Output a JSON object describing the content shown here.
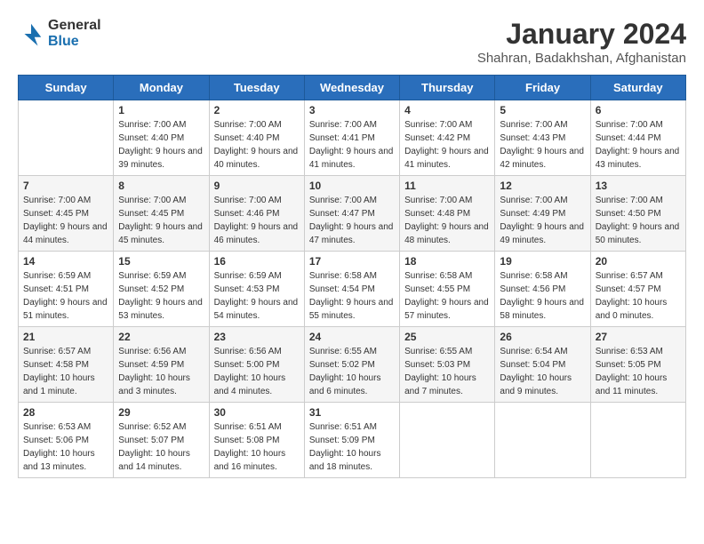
{
  "logo": {
    "general": "General",
    "blue": "Blue"
  },
  "title": "January 2024",
  "subtitle": "Shahran, Badakhshan, Afghanistan",
  "days_header": [
    "Sunday",
    "Monday",
    "Tuesday",
    "Wednesday",
    "Thursday",
    "Friday",
    "Saturday"
  ],
  "weeks": [
    [
      {
        "day": "",
        "sunrise": "",
        "sunset": "",
        "daylight": ""
      },
      {
        "day": "1",
        "sunrise": "Sunrise: 7:00 AM",
        "sunset": "Sunset: 4:40 PM",
        "daylight": "Daylight: 9 hours and 39 minutes."
      },
      {
        "day": "2",
        "sunrise": "Sunrise: 7:00 AM",
        "sunset": "Sunset: 4:40 PM",
        "daylight": "Daylight: 9 hours and 40 minutes."
      },
      {
        "day": "3",
        "sunrise": "Sunrise: 7:00 AM",
        "sunset": "Sunset: 4:41 PM",
        "daylight": "Daylight: 9 hours and 41 minutes."
      },
      {
        "day": "4",
        "sunrise": "Sunrise: 7:00 AM",
        "sunset": "Sunset: 4:42 PM",
        "daylight": "Daylight: 9 hours and 41 minutes."
      },
      {
        "day": "5",
        "sunrise": "Sunrise: 7:00 AM",
        "sunset": "Sunset: 4:43 PM",
        "daylight": "Daylight: 9 hours and 42 minutes."
      },
      {
        "day": "6",
        "sunrise": "Sunrise: 7:00 AM",
        "sunset": "Sunset: 4:44 PM",
        "daylight": "Daylight: 9 hours and 43 minutes."
      }
    ],
    [
      {
        "day": "7",
        "sunrise": "Sunrise: 7:00 AM",
        "sunset": "Sunset: 4:45 PM",
        "daylight": "Daylight: 9 hours and 44 minutes."
      },
      {
        "day": "8",
        "sunrise": "Sunrise: 7:00 AM",
        "sunset": "Sunset: 4:45 PM",
        "daylight": "Daylight: 9 hours and 45 minutes."
      },
      {
        "day": "9",
        "sunrise": "Sunrise: 7:00 AM",
        "sunset": "Sunset: 4:46 PM",
        "daylight": "Daylight: 9 hours and 46 minutes."
      },
      {
        "day": "10",
        "sunrise": "Sunrise: 7:00 AM",
        "sunset": "Sunset: 4:47 PM",
        "daylight": "Daylight: 9 hours and 47 minutes."
      },
      {
        "day": "11",
        "sunrise": "Sunrise: 7:00 AM",
        "sunset": "Sunset: 4:48 PM",
        "daylight": "Daylight: 9 hours and 48 minutes."
      },
      {
        "day": "12",
        "sunrise": "Sunrise: 7:00 AM",
        "sunset": "Sunset: 4:49 PM",
        "daylight": "Daylight: 9 hours and 49 minutes."
      },
      {
        "day": "13",
        "sunrise": "Sunrise: 7:00 AM",
        "sunset": "Sunset: 4:50 PM",
        "daylight": "Daylight: 9 hours and 50 minutes."
      }
    ],
    [
      {
        "day": "14",
        "sunrise": "Sunrise: 6:59 AM",
        "sunset": "Sunset: 4:51 PM",
        "daylight": "Daylight: 9 hours and 51 minutes."
      },
      {
        "day": "15",
        "sunrise": "Sunrise: 6:59 AM",
        "sunset": "Sunset: 4:52 PM",
        "daylight": "Daylight: 9 hours and 53 minutes."
      },
      {
        "day": "16",
        "sunrise": "Sunrise: 6:59 AM",
        "sunset": "Sunset: 4:53 PM",
        "daylight": "Daylight: 9 hours and 54 minutes."
      },
      {
        "day": "17",
        "sunrise": "Sunrise: 6:58 AM",
        "sunset": "Sunset: 4:54 PM",
        "daylight": "Daylight: 9 hours and 55 minutes."
      },
      {
        "day": "18",
        "sunrise": "Sunrise: 6:58 AM",
        "sunset": "Sunset: 4:55 PM",
        "daylight": "Daylight: 9 hours and 57 minutes."
      },
      {
        "day": "19",
        "sunrise": "Sunrise: 6:58 AM",
        "sunset": "Sunset: 4:56 PM",
        "daylight": "Daylight: 9 hours and 58 minutes."
      },
      {
        "day": "20",
        "sunrise": "Sunrise: 6:57 AM",
        "sunset": "Sunset: 4:57 PM",
        "daylight": "Daylight: 10 hours and 0 minutes."
      }
    ],
    [
      {
        "day": "21",
        "sunrise": "Sunrise: 6:57 AM",
        "sunset": "Sunset: 4:58 PM",
        "daylight": "Daylight: 10 hours and 1 minute."
      },
      {
        "day": "22",
        "sunrise": "Sunrise: 6:56 AM",
        "sunset": "Sunset: 4:59 PM",
        "daylight": "Daylight: 10 hours and 3 minutes."
      },
      {
        "day": "23",
        "sunrise": "Sunrise: 6:56 AM",
        "sunset": "Sunset: 5:00 PM",
        "daylight": "Daylight: 10 hours and 4 minutes."
      },
      {
        "day": "24",
        "sunrise": "Sunrise: 6:55 AM",
        "sunset": "Sunset: 5:02 PM",
        "daylight": "Daylight: 10 hours and 6 minutes."
      },
      {
        "day": "25",
        "sunrise": "Sunrise: 6:55 AM",
        "sunset": "Sunset: 5:03 PM",
        "daylight": "Daylight: 10 hours and 7 minutes."
      },
      {
        "day": "26",
        "sunrise": "Sunrise: 6:54 AM",
        "sunset": "Sunset: 5:04 PM",
        "daylight": "Daylight: 10 hours and 9 minutes."
      },
      {
        "day": "27",
        "sunrise": "Sunrise: 6:53 AM",
        "sunset": "Sunset: 5:05 PM",
        "daylight": "Daylight: 10 hours and 11 minutes."
      }
    ],
    [
      {
        "day": "28",
        "sunrise": "Sunrise: 6:53 AM",
        "sunset": "Sunset: 5:06 PM",
        "daylight": "Daylight: 10 hours and 13 minutes."
      },
      {
        "day": "29",
        "sunrise": "Sunrise: 6:52 AM",
        "sunset": "Sunset: 5:07 PM",
        "daylight": "Daylight: 10 hours and 14 minutes."
      },
      {
        "day": "30",
        "sunrise": "Sunrise: 6:51 AM",
        "sunset": "Sunset: 5:08 PM",
        "daylight": "Daylight: 10 hours and 16 minutes."
      },
      {
        "day": "31",
        "sunrise": "Sunrise: 6:51 AM",
        "sunset": "Sunset: 5:09 PM",
        "daylight": "Daylight: 10 hours and 18 minutes."
      },
      {
        "day": "",
        "sunrise": "",
        "sunset": "",
        "daylight": ""
      },
      {
        "day": "",
        "sunrise": "",
        "sunset": "",
        "daylight": ""
      },
      {
        "day": "",
        "sunrise": "",
        "sunset": "",
        "daylight": ""
      }
    ]
  ]
}
